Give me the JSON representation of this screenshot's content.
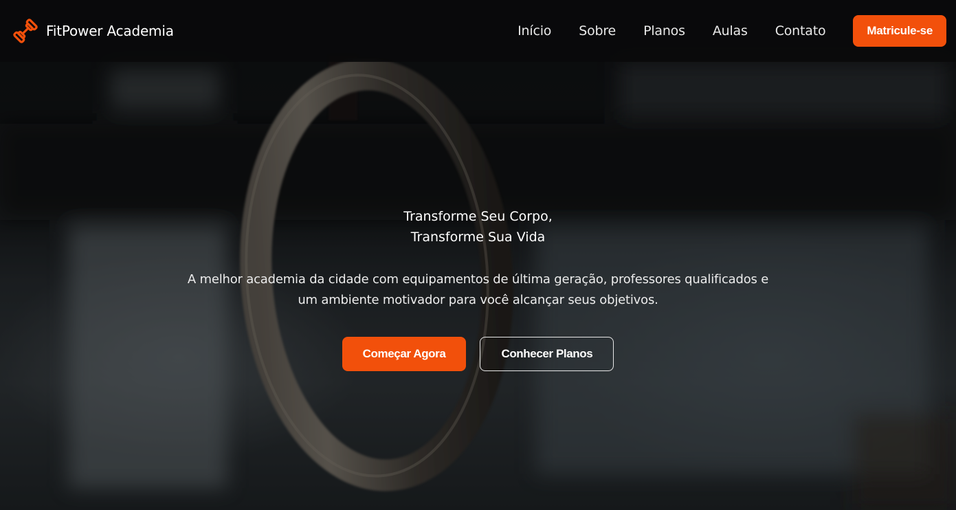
{
  "brand": {
    "name": "FitPower Academia",
    "icon": "dumbbell-icon",
    "accent_color": "#f2500b"
  },
  "nav": {
    "links": [
      {
        "label": "Início"
      },
      {
        "label": "Sobre"
      },
      {
        "label": "Planos"
      },
      {
        "label": "Aulas"
      },
      {
        "label": "Contato"
      }
    ],
    "cta_label": "Matricule-se"
  },
  "hero": {
    "title_line1": "Transforme Seu Corpo,",
    "title_line2": "Transforme Sua Vida",
    "subtitle_line1": "A melhor academia da cidade com equipamentos de última geração, professores qualificados e",
    "subtitle_line2": "um ambiente motivador para você alcançar seus objetivos.",
    "primary_button": "Começar Agora",
    "secondary_button": "Conhecer Planos"
  }
}
